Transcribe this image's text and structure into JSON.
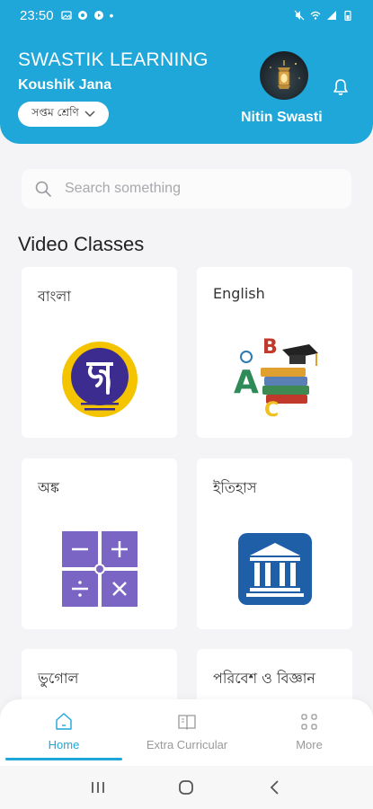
{
  "status_bar": {
    "time": "23:50"
  },
  "header": {
    "brand": "SWASTIK LEARNING",
    "user_name": "Koushik Jana",
    "class_selector": "সপ্তম শ্রেণি",
    "profile_name": "Nitin Swasti"
  },
  "search": {
    "placeholder": "Search something"
  },
  "section": {
    "title": "Video Classes"
  },
  "subjects": [
    {
      "label": "বাংলা",
      "icon": "bangla-letter-icon"
    },
    {
      "label": "English",
      "icon": "abc-books-icon"
    },
    {
      "label": "অঙ্ক",
      "icon": "math-operators-icon"
    },
    {
      "label": "ইতিহাস",
      "icon": "museum-icon"
    },
    {
      "label": "ভুগোল",
      "icon": ""
    },
    {
      "label": "পরিবেশ ও বিজ্ঞান",
      "icon": ""
    }
  ],
  "nav": [
    {
      "label": "Home",
      "icon": "home-icon",
      "active": true
    },
    {
      "label": "Extra Curricular",
      "icon": "book-icon",
      "active": false
    },
    {
      "label": "More",
      "icon": "grid-icon",
      "active": false
    }
  ],
  "colors": {
    "accent": "#1ea7d8",
    "card_bg": "#ffffff",
    "page_bg": "#f4f4f6"
  }
}
